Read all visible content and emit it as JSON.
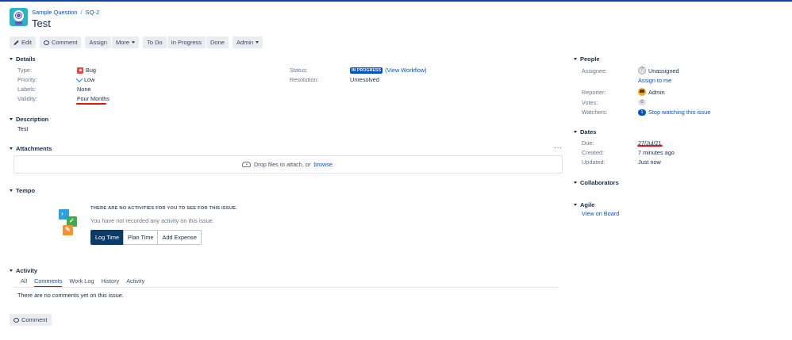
{
  "breadcrumb": {
    "project": "Sample Question",
    "separator": "/",
    "key": "SQ-2"
  },
  "issue": {
    "title": "Test"
  },
  "toolbar": {
    "edit": "Edit",
    "comment": "Comment",
    "assign": "Assign",
    "more": "More",
    "todo": "To Do",
    "in_progress": "In Progress",
    "done": "Done",
    "admin": "Admin"
  },
  "details": {
    "heading": "Details",
    "type_label": "Type:",
    "type_value": "Bug",
    "priority_label": "Priority:",
    "priority_value": "Low",
    "labels_label": "Labels:",
    "labels_value": "None",
    "validity_label": "Validity:",
    "validity_value": "Four Months",
    "status_label": "Status:",
    "status_value": "IN PROGRESS",
    "view_workflow": "(View Workflow)",
    "resolution_label": "Resolution:",
    "resolution_value": "Unresolved"
  },
  "description": {
    "heading": "Description",
    "text": "Test"
  },
  "attachments": {
    "heading": "Attachments",
    "more": "···",
    "drop_text": "Drop files to attach, or",
    "browse": "browse."
  },
  "tempo": {
    "heading": "Tempo",
    "empty_title": "THERE ARE NO ACTIVITIES FOR YOU TO SEE FOR THIS ISSUE.",
    "empty_sub": "You have not recorded any activity on this issue.",
    "log_time": "Log Time",
    "plan_time": "Plan Time",
    "add_expense": "Add Expense"
  },
  "activity": {
    "heading": "Activity",
    "tabs": [
      "All",
      "Comments",
      "Work Log",
      "History",
      "Activity"
    ],
    "active_tab": "Comments",
    "empty": "There are no comments yet on this issue."
  },
  "footer": {
    "comment": "Comment"
  },
  "people": {
    "heading": "People",
    "assignee_label": "Assignee:",
    "assignee_value": "Unassigned",
    "assign_to_me": "Assign to me",
    "reporter_label": "Reporter:",
    "reporter_value": "Admin",
    "votes_label": "Votes:",
    "votes_count": "0",
    "watchers_label": "Watchers:",
    "watchers_count": "1",
    "stop_watching": "Stop watching this issue"
  },
  "dates": {
    "heading": "Dates",
    "due_label": "Due:",
    "due_value": "27/Jul/21",
    "created_label": "Created:",
    "created_value": "7 minutes ago",
    "updated_label": "Updated:",
    "updated_value": "Just now"
  },
  "collaborators": {
    "heading": "Collaborators"
  },
  "agile": {
    "heading": "Agile",
    "view_on_board": "View on Board"
  },
  "colors": {
    "link": "#0052cc",
    "status": "#0052cc",
    "annotation": "#e01515"
  }
}
